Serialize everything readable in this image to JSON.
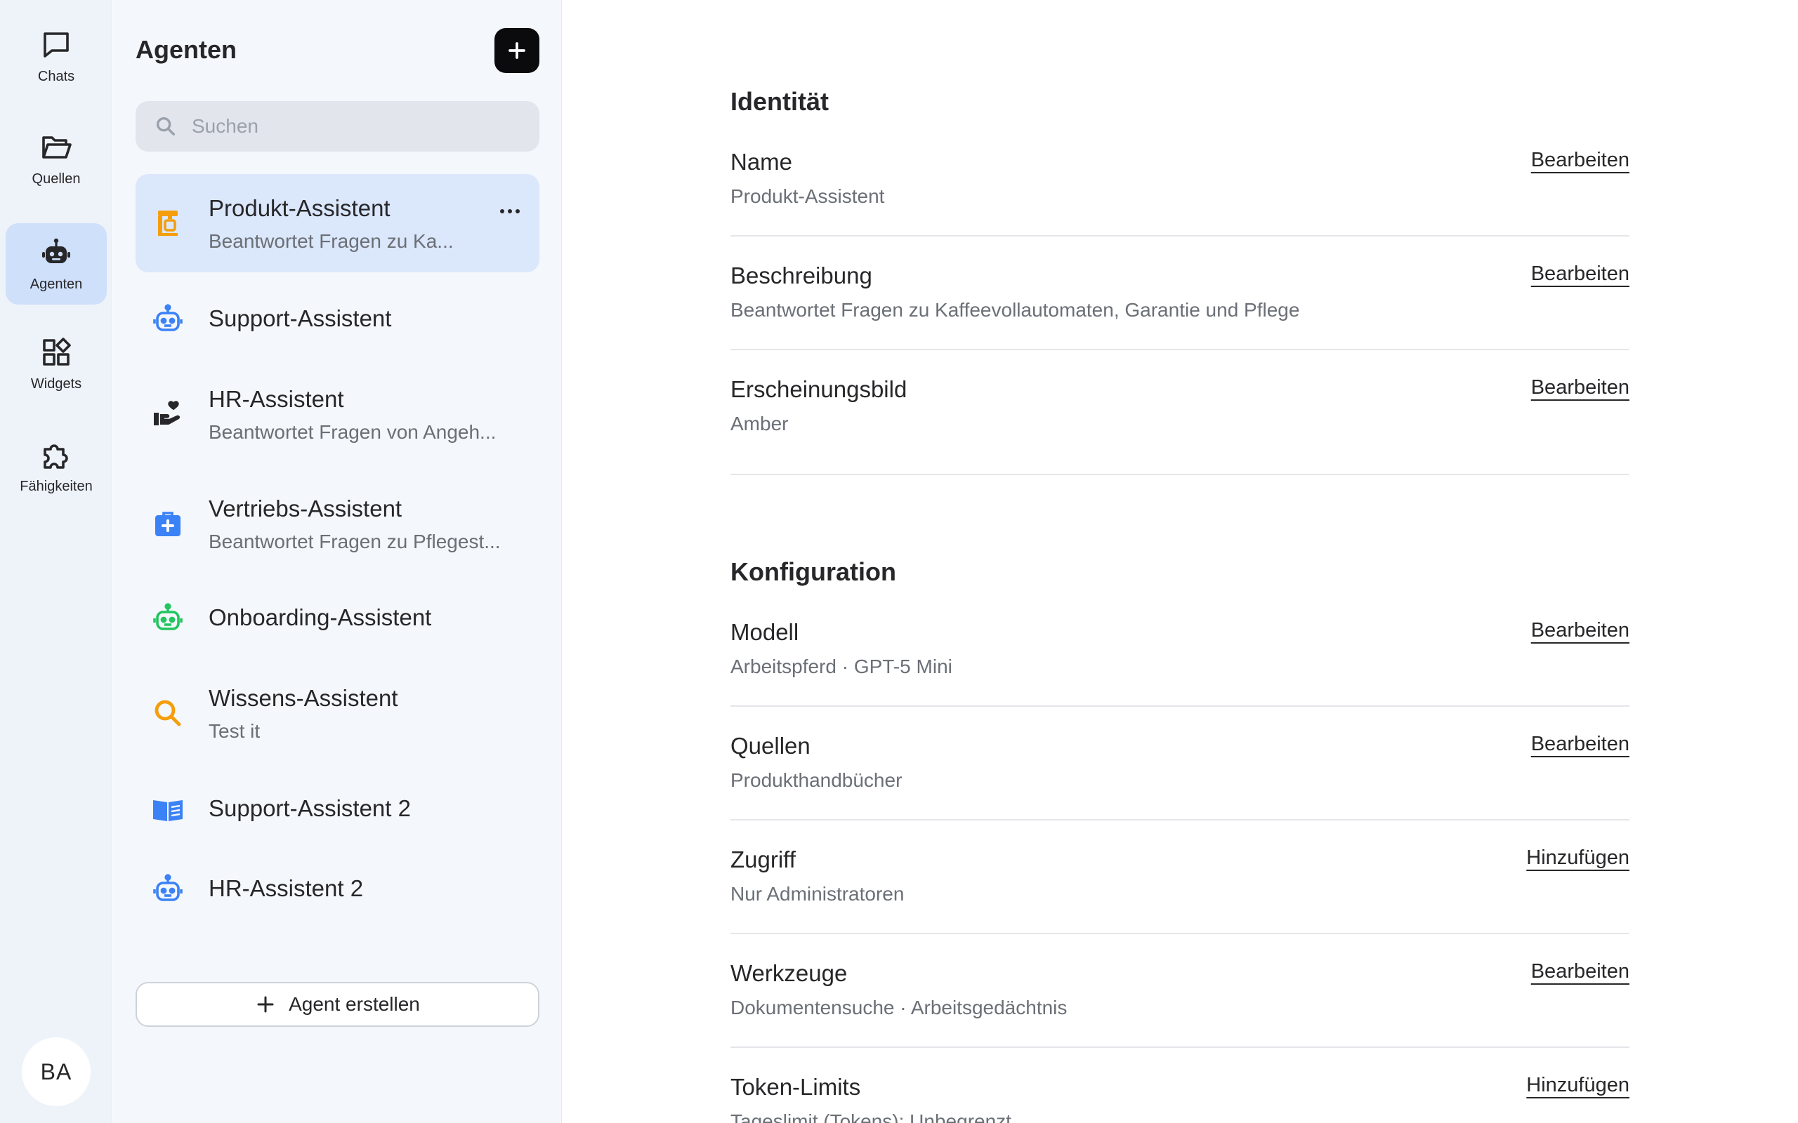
{
  "rail": {
    "items": [
      {
        "label": "Chats",
        "icon": "chat-icon"
      },
      {
        "label": "Quellen",
        "icon": "folder-open-icon"
      },
      {
        "label": "Agenten",
        "icon": "robot-icon",
        "active": true
      },
      {
        "label": "Widgets",
        "icon": "widgets-icon"
      },
      {
        "label": "Fähigkeiten",
        "icon": "puzzle-icon"
      }
    ],
    "avatar_initials": "BA"
  },
  "agents_panel": {
    "title": "Agenten",
    "search_placeholder": "Suchen",
    "agents": [
      {
        "name": "Produkt-Assistent",
        "description": "Beantwortet Fragen zu Ka...",
        "icon": "coffee-machine-icon",
        "color": "#f59e0b",
        "active": true
      },
      {
        "name": "Support-Assistent",
        "description": "",
        "icon": "robot-icon",
        "color": "#3b82f6"
      },
      {
        "name": "HR-Assistent",
        "description": "Beantwortet Fragen von Angeh...",
        "icon": "hand-heart-icon",
        "color": "#27272a"
      },
      {
        "name": "Vertriebs-Assistent",
        "description": "Beantwortet Fragen zu Pflegest...",
        "icon": "medical-bag-icon",
        "color": "#3b82f6"
      },
      {
        "name": "Onboarding-Assistent",
        "description": "",
        "icon": "robot-icon",
        "color": "#22c55e"
      },
      {
        "name": "Wissens-Assistent",
        "description": "Test it",
        "icon": "magnify-icon",
        "color": "#f59e0b"
      },
      {
        "name": "Support-Assistent 2",
        "description": "",
        "icon": "book-open-icon",
        "color": "#3b82f6"
      },
      {
        "name": "HR-Assistent 2",
        "description": "",
        "icon": "robot-icon",
        "color": "#3b82f6"
      }
    ],
    "create_button": "Agent erstellen"
  },
  "identity": {
    "title": "Identität",
    "rows": [
      {
        "label": "Name",
        "value": "Produkt-Assistent",
        "action": "Bearbeiten"
      },
      {
        "label": "Beschreibung",
        "value": "Beantwortet Fragen zu Kaffeevollautomaten, Garantie und Pflege",
        "action": "Bearbeiten"
      },
      {
        "label": "Erscheinungsbild",
        "value": "Amber",
        "action": "Bearbeiten"
      }
    ]
  },
  "config": {
    "title": "Konfiguration",
    "rows": [
      {
        "label": "Modell",
        "value": "Arbeitspferd · GPT-5 Mini",
        "action": "Bearbeiten"
      },
      {
        "label": "Quellen",
        "value": "Produkthandbücher",
        "action": "Bearbeiten"
      },
      {
        "label": "Zugriff",
        "value": "Nur Administratoren",
        "action": "Hinzufügen"
      },
      {
        "label": "Werkzeuge",
        "value": "Dokumentensuche · Arbeitsgedächtnis",
        "action": "Bearbeiten"
      },
      {
        "label": "Token-Limits",
        "value": "Tageslimit (Tokens): Unbegrenzt",
        "action": "Hinzufügen"
      }
    ]
  }
}
